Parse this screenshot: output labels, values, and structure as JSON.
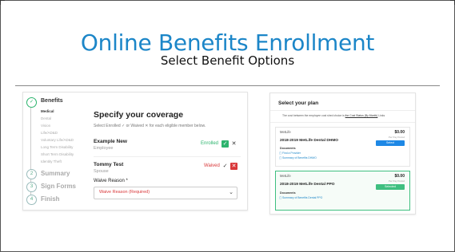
{
  "slide": {
    "title": "Online Benefits Enrollment",
    "subtitle": "Select Benefit Options"
  },
  "enrollment": {
    "steps": [
      {
        "label": "Benefits",
        "number": "",
        "icon": "check-circle-icon"
      },
      {
        "label": "Summary",
        "number": "2"
      },
      {
        "label": "Sign Forms",
        "number": "3"
      },
      {
        "label": "Finish",
        "number": "4"
      }
    ],
    "benefit_items": [
      "Medical",
      "Dental",
      "Vision",
      "Life/AD&D",
      "Voluntary Life/AD&D",
      "Long Term Disability",
      "Short Term Disability",
      "Identity Theft"
    ],
    "heading": "Specify your coverage",
    "hint": "Select Enrolled ✓ or Waived ✕ for each eligible member below.",
    "members": [
      {
        "name": "Example New",
        "role": "Employee",
        "status": "Enrolled"
      },
      {
        "name": "Tommy Test",
        "role": "Spouse",
        "status": "Waived"
      }
    ],
    "waive_reason_label": "Waive Reason *",
    "waive_reason_value": "Waive Reason (Required)"
  },
  "plan_select": {
    "heading": "Select your plan",
    "note_prefix": "The cost between the employee cost shed choice is ",
    "note_link": "the Cost Status (By Month)",
    "note_suffix": " Links",
    "plans": [
      {
        "carrier": "MetLife",
        "name": "2018-2019 MetLife Dental DHMO",
        "price": "$0.00",
        "period": "Per Pay Period",
        "button": "Select",
        "docs_label": "Documents",
        "docs": [
          "Find a Provider",
          "Summary of Benefits DHMO"
        ]
      },
      {
        "carrier": "MetLife",
        "name": "2018-2019 MetLife Dental PPO",
        "price": "$0.00",
        "period": "Per Pay Period",
        "button": "Selected",
        "docs_label": "Documents",
        "docs": [
          "Summary of Benefits Dental PPO"
        ]
      }
    ]
  },
  "colors": {
    "title": "#1c86c8",
    "enrolled": "#2db46e",
    "waived": "#d9383a",
    "select": "#1e88e5"
  }
}
